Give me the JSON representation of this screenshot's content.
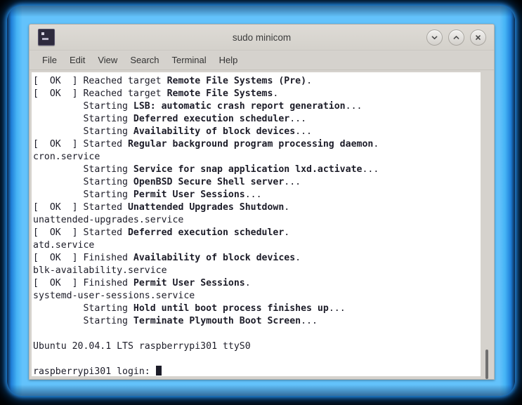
{
  "window": {
    "title": "sudo minicom",
    "app_icon": "terminal-icon",
    "controls": [
      {
        "name": "minimize-button",
        "glyph": "chevron-down-icon"
      },
      {
        "name": "maximize-button",
        "glyph": "chevron-up-icon"
      },
      {
        "name": "close-button",
        "glyph": "close-icon"
      }
    ]
  },
  "menubar": {
    "items": [
      {
        "label": "File"
      },
      {
        "label": "Edit"
      },
      {
        "label": "View"
      },
      {
        "label": "Search"
      },
      {
        "label": "Terminal"
      },
      {
        "label": "Help"
      }
    ]
  },
  "terminal": {
    "lines": [
      {
        "plain": "[  OK  ] Reached target ",
        "bold": "Remote File Systems (Pre)",
        "tail": "."
      },
      {
        "plain": "[  OK  ] Reached target ",
        "bold": "Remote File Systems",
        "tail": "."
      },
      {
        "plain": "         Starting ",
        "bold": "LSB: automatic crash report generation",
        "tail": "..."
      },
      {
        "plain": "         Starting ",
        "bold": "Deferred execution scheduler",
        "tail": "..."
      },
      {
        "plain": "         Starting ",
        "bold": "Availability of block devices",
        "tail": "..."
      },
      {
        "plain": "[  OK  ] Started ",
        "bold": "Regular background program processing daemon",
        "tail": "."
      },
      {
        "plain": "cron.service",
        "bold": "",
        "tail": ""
      },
      {
        "plain": "         Starting ",
        "bold": "Service for snap application lxd.activate",
        "tail": "..."
      },
      {
        "plain": "         Starting ",
        "bold": "OpenBSD Secure Shell server",
        "tail": "..."
      },
      {
        "plain": "         Starting ",
        "bold": "Permit User Sessions",
        "tail": "..."
      },
      {
        "plain": "[  OK  ] Started ",
        "bold": "Unattended Upgrades Shutdown",
        "tail": "."
      },
      {
        "plain": "unattended-upgrades.service",
        "bold": "",
        "tail": ""
      },
      {
        "plain": "[  OK  ] Started ",
        "bold": "Deferred execution scheduler",
        "tail": "."
      },
      {
        "plain": "atd.service",
        "bold": "",
        "tail": ""
      },
      {
        "plain": "[  OK  ] Finished ",
        "bold": "Availability of block devices",
        "tail": "."
      },
      {
        "plain": "blk-availability.service",
        "bold": "",
        "tail": ""
      },
      {
        "plain": "[  OK  ] Finished ",
        "bold": "Permit User Sessions",
        "tail": "."
      },
      {
        "plain": "systemd-user-sessions.service",
        "bold": "",
        "tail": ""
      },
      {
        "plain": "         Starting ",
        "bold": "Hold until boot process finishes up",
        "tail": "..."
      },
      {
        "plain": "         Starting ",
        "bold": "Terminate Plymouth Boot Screen",
        "tail": "..."
      },
      {
        "plain": "",
        "bold": "",
        "tail": ""
      },
      {
        "plain": "Ubuntu 20.04.1 LTS raspberrypi301 ttyS0",
        "bold": "",
        "tail": ""
      },
      {
        "plain": "",
        "bold": "",
        "tail": ""
      },
      {
        "plain": "raspberrypi301 login: ",
        "bold": "",
        "tail": "",
        "cursor": true
      }
    ]
  },
  "colors": {
    "glow_blue": "#45b3f5",
    "chrome_gray": "#d5d2cd",
    "terminal_bg": "#ffffff",
    "terminal_fg": "#1c1c28"
  }
}
